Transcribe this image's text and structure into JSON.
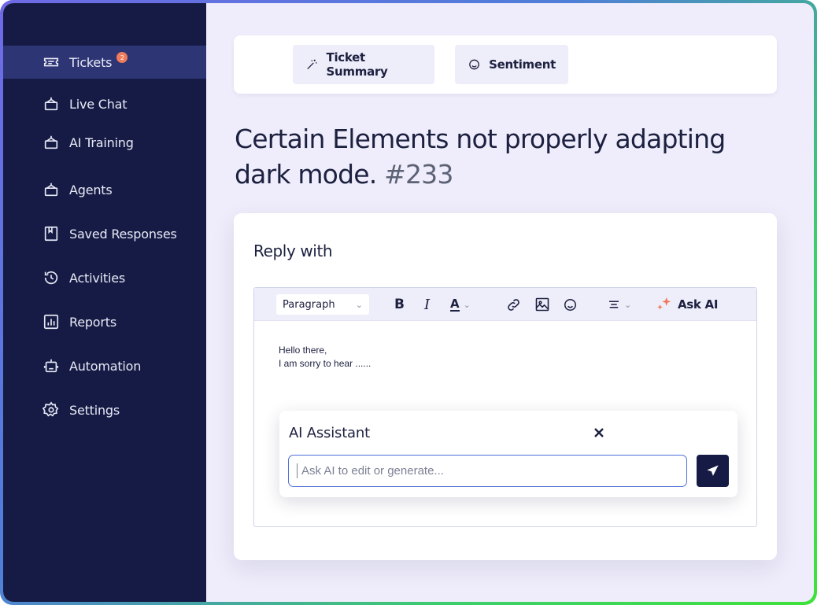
{
  "sidebar": {
    "items": [
      {
        "label": "Tickets",
        "badge": "2",
        "icon": "ticket-icon",
        "active": true
      },
      {
        "label": "Live Chat",
        "icon": "bot-icon"
      },
      {
        "label": "AI Training",
        "icon": "bot-icon"
      },
      {
        "label": "Agents",
        "icon": "bot-icon"
      },
      {
        "label": "Saved Responses",
        "icon": "bookmark-icon"
      },
      {
        "label": "Activities",
        "icon": "history-icon"
      },
      {
        "label": "Reports",
        "icon": "bar-chart-icon"
      },
      {
        "label": "Automation",
        "icon": "robot-icon"
      },
      {
        "label": "Settings",
        "icon": "gear-icon"
      }
    ]
  },
  "top_actions": {
    "summary_label": "Ticket Summary",
    "sentiment_label": "Sentiment"
  },
  "ticket": {
    "title": "Certain Elements not properly adapting dark mode.",
    "number": "#233"
  },
  "reply": {
    "heading": "Reply with",
    "toolbar": {
      "paragraph": "Paragraph",
      "bold": "B",
      "italic": "I",
      "text_color": "A",
      "ask_ai": "Ask AI"
    },
    "body_lines": [
      "Hello there,",
      "I am sorry to hear ......"
    ]
  },
  "ai_assistant": {
    "title": "AI Assistant",
    "placeholder": "Ask AI to edit or generate..."
  },
  "colors": {
    "sidebar_bg": "#161b45",
    "active_item_bg": "#2e3574",
    "page_bg": "#efedfb",
    "accent_orange": "#f07b5a",
    "send_button": "#161b45"
  }
}
